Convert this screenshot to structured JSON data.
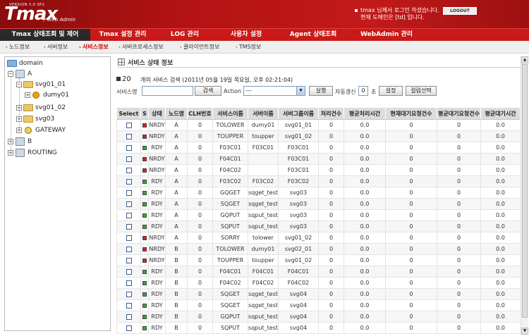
{
  "header": {
    "version": "VERSION 5.0 SP2",
    "logo": "Tmax",
    "logo_sub": "/ Web Admin",
    "login_line1": "tmax 님께서 로그인 하셨습니다.",
    "login_line2": "현재 도메인은 [td] 입니다.",
    "logout_label": "LOGOUT"
  },
  "main_menu": [
    {
      "label": "Tmax 상태조회 및 제어"
    },
    {
      "label": "Tmax 설정 관리"
    },
    {
      "label": "LOG 관리"
    },
    {
      "label": "사용자 설정"
    },
    {
      "label": "Agent 상태조회"
    },
    {
      "label": "WebAdmin 관리"
    }
  ],
  "sub_menu": [
    {
      "label": "노드정보"
    },
    {
      "label": "서버정보"
    },
    {
      "label": "서비스정보"
    },
    {
      "label": "서버프로세스정보"
    },
    {
      "label": "클라이언트정보"
    },
    {
      "label": "TMS정보"
    }
  ],
  "tree": {
    "root": "domain",
    "nodes": [
      "A",
      "svg01_01",
      "dumy01",
      "svg01_02",
      "svg03",
      "GATEWAY",
      "B",
      "ROUTING"
    ]
  },
  "content": {
    "title": "서비스 상태 정보",
    "count": "20",
    "count_text": "개의 서비스 검색 (2011년 05월 19일 목요일, 오후 02:21:04)",
    "service_name_label": "서비스명",
    "search_button": "검색",
    "action_label": "Action",
    "action_value": "---",
    "run_button": "실행",
    "auto_refresh_label": "자동갱신",
    "auto_refresh_value": "0",
    "sec_label": "초",
    "settings_button": "설정",
    "column_select_button": "컬럼선택"
  },
  "table": {
    "headers": [
      "Select",
      "S",
      "상태",
      "노드명",
      "CLH번호",
      "서비스이름",
      "서버이름",
      "서버그룹이름",
      "처리건수",
      "평균처리시간",
      "현재대기요청건수",
      "평균대기요청건수",
      "평균대기시간"
    ],
    "rows": [
      [
        "NRDY",
        "A",
        "0",
        "TOLOWER",
        "dumy01",
        "svg01_01",
        "0",
        "0.0",
        "0",
        "0",
        "0.0"
      ],
      [
        "NRDY",
        "A",
        "0",
        "TOUPPER",
        "toupper",
        "svg01_02",
        "0",
        "0.0",
        "0",
        "0",
        "0.0"
      ],
      [
        "RDY",
        "A",
        "0",
        "F03C01",
        "F03C01",
        "F03C01",
        "0",
        "0.0",
        "0",
        "0",
        "0.0"
      ],
      [
        "NRDY",
        "A",
        "0",
        "F04C01",
        "",
        "F03C01",
        "0",
        "0.0",
        "0",
        "0",
        "0.0"
      ],
      [
        "NRDY",
        "A",
        "0",
        "F04C02",
        "",
        "F03C01",
        "0",
        "0.0",
        "0",
        "0",
        "0.0"
      ],
      [
        "RDY",
        "A",
        "0",
        "F03C02",
        "F03C02",
        "F03C02",
        "0",
        "0.0",
        "0",
        "0",
        "0.0"
      ],
      [
        "RDY",
        "A",
        "0",
        "GQGET",
        "sqget_test",
        "svg03",
        "0",
        "0.0",
        "0",
        "0",
        "0.0"
      ],
      [
        "RDY",
        "A",
        "0",
        "SQGET",
        "sqget_test",
        "svg03",
        "0",
        "0.0",
        "0",
        "0",
        "0.0"
      ],
      [
        "RDY",
        "A",
        "0",
        "GQPUT",
        "sqput_test",
        "svg03",
        "0",
        "0.0",
        "0",
        "0",
        "0.0"
      ],
      [
        "RDY",
        "A",
        "0",
        "SQPUT",
        "sqput_test",
        "svg03",
        "0",
        "0.0",
        "0",
        "0",
        "0.0"
      ],
      [
        "NRDY",
        "A",
        "0",
        "SORRY",
        "tolower",
        "svg01_02",
        "0",
        "0.0",
        "0",
        "0",
        "0.0"
      ],
      [
        "NRDY",
        "B",
        "0",
        "TOLOWER",
        "dumy01",
        "svg02_01",
        "0",
        "0.0",
        "0",
        "0",
        "0.0"
      ],
      [
        "NRDY",
        "B",
        "0",
        "TOUPPER",
        "toupper",
        "svg01_02",
        "0",
        "0.0",
        "0",
        "0",
        "0.0"
      ],
      [
        "RDY",
        "B",
        "0",
        "F04C01",
        "F04C01",
        "F04C01",
        "0",
        "0.0",
        "0",
        "0",
        "0.0"
      ],
      [
        "RDY",
        "B",
        "0",
        "F04C02",
        "F04C02",
        "F04C02",
        "0",
        "0.0",
        "0",
        "0",
        "0.0"
      ],
      [
        "RDY",
        "B",
        "0",
        "SQGET",
        "sqget_test",
        "svg04",
        "0",
        "0.0",
        "0",
        "0",
        "0.0"
      ],
      [
        "RDY",
        "B",
        "0",
        "SQGET",
        "sqget_test",
        "svg04",
        "0",
        "0.0",
        "0",
        "0",
        "0.0"
      ],
      [
        "RDY",
        "B",
        "0",
        "GQPUT",
        "sqput_test",
        "svg04",
        "0",
        "0.0",
        "0",
        "0",
        "0.0"
      ],
      [
        "RDY",
        "B",
        "0",
        "SQPUT",
        "sqput_test",
        "svg04",
        "0",
        "0.0",
        "0",
        "0",
        "0.0"
      ]
    ]
  },
  "colors": {
    "header_red": "#b31313",
    "menu_active": "#2a2a2a",
    "status_ready": "#2eaa2e",
    "status_not_ready": "#d81f1f"
  }
}
